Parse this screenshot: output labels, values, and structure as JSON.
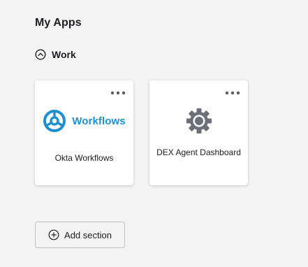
{
  "page": {
    "title": "My Apps"
  },
  "section": {
    "title": "Work",
    "collapse_icon": "chevron-up-circle-icon"
  },
  "apps": [
    {
      "name": "Okta Workflows",
      "logo_text": "Workflows",
      "logo_icon": "workflows-logo-icon",
      "menu_icon": "more-horizontal-icon"
    },
    {
      "name": "DEX Agent Dashboard",
      "logo_icon": "gear-icon",
      "menu_icon": "more-horizontal-icon"
    }
  ],
  "add_section": {
    "label": "Add section",
    "icon": "plus-circle-icon"
  },
  "colors": {
    "background": "#f4f4f4",
    "card": "#ffffff",
    "workflows_blue": "#1f8fd0",
    "gear_gray": "#6e6e78",
    "text": "#1d1d21"
  }
}
